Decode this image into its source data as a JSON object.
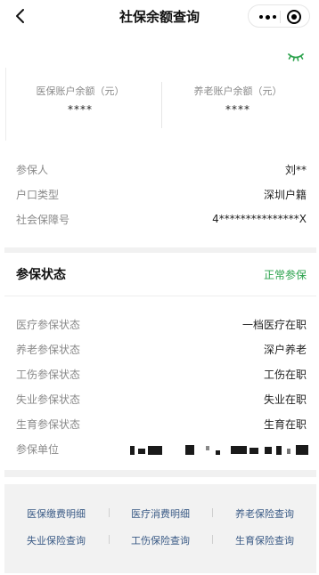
{
  "navbar": {
    "title": "社保余额查询"
  },
  "balance": {
    "medical_label": "医保账户余额（元）",
    "medical_value": "****",
    "pension_label": "养老账户余额（元）",
    "pension_value": "****",
    "accent_color": "#2ba24c"
  },
  "info": [
    {
      "key": "参保人",
      "value": "刘**"
    },
    {
      "key": "户口类型",
      "value": "深圳户籍"
    },
    {
      "key": "社会保障号",
      "value": "4***************X"
    }
  ],
  "status": {
    "title": "参保状态",
    "value": "正常参保",
    "rows": [
      {
        "key": "医疗参保状态",
        "value": "一档医疗在职"
      },
      {
        "key": "养老参保状态",
        "value": "深户养老"
      },
      {
        "key": "工伤参保状态",
        "value": "工伤在职"
      },
      {
        "key": "失业参保状态",
        "value": "失业在职"
      },
      {
        "key": "生育参保状态",
        "value": "生育在职"
      }
    ],
    "unit_label": "参保单位"
  },
  "footer": {
    "links": [
      "医保缴费明细",
      "医疗消费明细",
      "养老保险查询",
      "失业保险查询",
      "工伤保险查询",
      "生育保险查询"
    ]
  }
}
